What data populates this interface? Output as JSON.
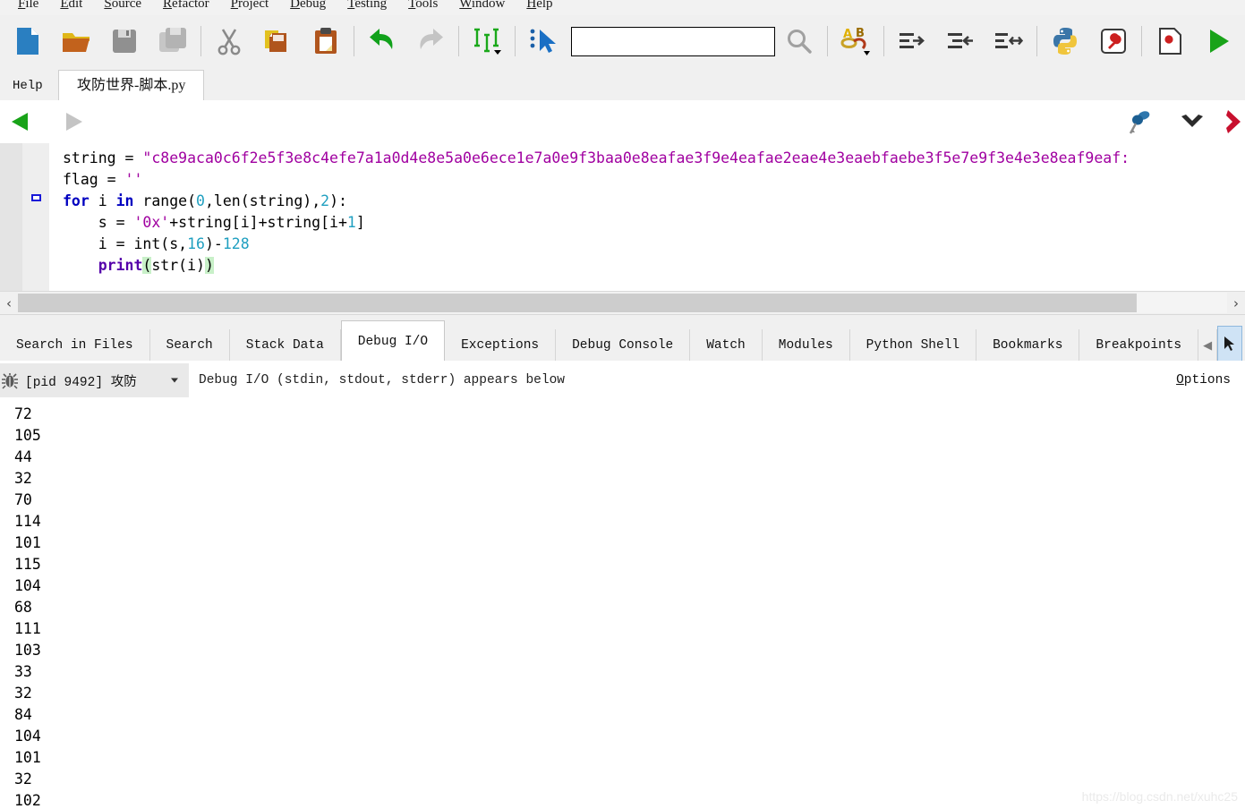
{
  "menu": {
    "items": [
      {
        "label": "File",
        "mnemonic": "F"
      },
      {
        "label": "Edit",
        "mnemonic": "E"
      },
      {
        "label": "Source",
        "mnemonic": "S"
      },
      {
        "label": "Refactor",
        "mnemonic": "R"
      },
      {
        "label": "Project",
        "mnemonic": "P"
      },
      {
        "label": "Debug",
        "mnemonic": "D"
      },
      {
        "label": "Testing",
        "mnemonic": "T"
      },
      {
        "label": "Tools",
        "mnemonic": "T"
      },
      {
        "label": "Window",
        "mnemonic": "W"
      },
      {
        "label": "Help",
        "mnemonic": "H"
      }
    ]
  },
  "toolbar": {
    "icons": [
      "new-file-icon",
      "open-folder-icon",
      "save-icon",
      "save-all-icon",
      "cut-icon",
      "copy-icon",
      "paste-icon",
      "undo-icon",
      "redo-icon",
      "indent-guides-icon",
      "select-pointer-icon"
    ],
    "search_placeholder": "",
    "search_value": "",
    "icons_right": [
      "search-icon",
      "find-replace-icon",
      "indent-right-icon",
      "indent-left-icon",
      "indent-both-icon",
      "python-icon",
      "configure-icon",
      "set-breakpoint-icon",
      "run-icon",
      "step-into-icon"
    ]
  },
  "editor_tabs": {
    "help_label": "Help",
    "file_label": "攻防世界-脚本.py"
  },
  "nav": {
    "back_label": "back",
    "forward_label": "forward",
    "pin_label": "pin",
    "chevron_down_label": "more",
    "chevron_right_label": "next"
  },
  "code": {
    "lines": [
      [
        {
          "t": "string ",
          "c": "plain"
        },
        {
          "t": "= ",
          "c": "plain"
        },
        {
          "t": "\"c8e9aca0c6f2e5f3e8c4efe7a1a0d4e8e5a0e6ece1e7a0e9f3baa0e8eafae3f9e4eafae2eae4e3eaebfaebe3f5e7e9f3e4e3e8eaf9eaf:",
          "c": "str"
        }
      ],
      [
        {
          "t": "flag ",
          "c": "plain"
        },
        {
          "t": "= ",
          "c": "plain"
        },
        {
          "t": "''",
          "c": "str"
        }
      ],
      [
        {
          "t": "for",
          "c": "kw"
        },
        {
          "t": " i ",
          "c": "plain"
        },
        {
          "t": "in",
          "c": "kw"
        },
        {
          "t": " range(",
          "c": "plain"
        },
        {
          "t": "0",
          "c": "num"
        },
        {
          "t": ",len(string),",
          "c": "plain"
        },
        {
          "t": "2",
          "c": "num"
        },
        {
          "t": "):",
          "c": "plain"
        }
      ],
      [
        {
          "t": "    s = ",
          "c": "plain"
        },
        {
          "t": "'0x'",
          "c": "str"
        },
        {
          "t": "+string[i]+string[i+",
          "c": "plain"
        },
        {
          "t": "1",
          "c": "num"
        },
        {
          "t": "]",
          "c": "plain"
        }
      ],
      [
        {
          "t": "    i = int(s,",
          "c": "plain"
        },
        {
          "t": "16",
          "c": "num"
        },
        {
          "t": ")-",
          "c": "plain"
        },
        {
          "t": "128",
          "c": "num"
        }
      ],
      [
        {
          "t": "    ",
          "c": "plain"
        },
        {
          "t": "print",
          "c": "bi"
        },
        {
          "t": "(",
          "c": "hl"
        },
        {
          "t": "str(i)",
          "c": "plain"
        },
        {
          "t": ")",
          "c": "hl"
        }
      ]
    ]
  },
  "hscroll": {
    "left_arrow": "‹",
    "right_arrow": "›"
  },
  "bottom_tabs": {
    "items": [
      {
        "label": "Search in Files",
        "active": false
      },
      {
        "label": "Search",
        "active": false
      },
      {
        "label": "Stack Data",
        "active": false
      },
      {
        "label": "Debug I/O",
        "active": true
      },
      {
        "label": "Exceptions",
        "active": false
      },
      {
        "label": "Debug Console",
        "active": false
      },
      {
        "label": "Watch",
        "active": false
      },
      {
        "label": "Modules",
        "active": false
      },
      {
        "label": "Python Shell",
        "active": false
      },
      {
        "label": "Bookmarks",
        "active": false
      },
      {
        "label": "Breakpoints",
        "active": false
      }
    ],
    "scroll_left": "◀",
    "scroll_right_icon": "tab-menu-icon"
  },
  "io_header": {
    "process_icon": "bug-icon",
    "process_label": "[pid 9492] 攻防",
    "note": "Debug I/O (stdin, stdout, stderr) appears below",
    "options_label": "Options",
    "options_mnemonic": "O"
  },
  "output": {
    "lines": [
      "72",
      "105",
      "44",
      "32",
      "70",
      "114",
      "101",
      "115",
      "104",
      "68",
      "111",
      "103",
      "33",
      "32",
      "84",
      "104",
      "101",
      "32",
      "102"
    ]
  },
  "watermark": {
    "text": "https://blog.csdn.net/xuhc25"
  },
  "colors": {
    "accent_green": "#17a317",
    "accent_red": "#c8102e",
    "string_purple": "#a000a0",
    "keyword_blue": "#0000c0",
    "number_cyan": "#1f9fc0",
    "toolbar_bg": "#f0f0f0",
    "active_tab_bg": "#ffffff"
  }
}
